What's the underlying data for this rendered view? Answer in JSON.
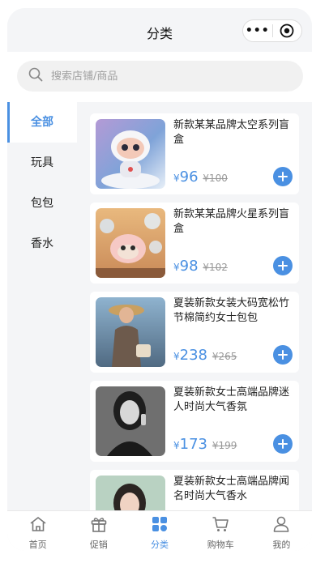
{
  "navbar": {
    "title": "分类"
  },
  "search": {
    "placeholder": "搜索店铺/商品"
  },
  "categories": [
    {
      "label": "全部",
      "active": true
    },
    {
      "label": "玩具",
      "active": false
    },
    {
      "label": "包包",
      "active": false
    },
    {
      "label": "香水",
      "active": false
    }
  ],
  "products": [
    {
      "name": "新款某某品牌太空系列盲盒",
      "currency": "¥",
      "price": "96",
      "old_price": "¥100"
    },
    {
      "name": "新款某某品牌火星系列盲盒",
      "currency": "¥",
      "price": "98",
      "old_price": "¥102"
    },
    {
      "name": "夏装新款女装大码宽松竹节棉简约女士包包",
      "currency": "¥",
      "price": "238",
      "old_price": "¥265"
    },
    {
      "name": "夏装新款女士高端品牌迷人时尚大气香氛",
      "currency": "¥",
      "price": "173",
      "old_price": "¥199"
    },
    {
      "name": "夏装新款女士高端品牌闻名时尚大气香水",
      "currency": "¥",
      "price": "",
      "old_price": ""
    }
  ],
  "tabbar": [
    {
      "label": "首页",
      "icon": "home-icon"
    },
    {
      "label": "促销",
      "icon": "gift-icon"
    },
    {
      "label": "分类",
      "icon": "category-icon",
      "active": true
    },
    {
      "label": "购物车",
      "icon": "cart-icon"
    },
    {
      "label": "我的",
      "icon": "user-icon"
    }
  ],
  "colors": {
    "accent": "#4a90e2",
    "background": "#f4f5f7"
  }
}
